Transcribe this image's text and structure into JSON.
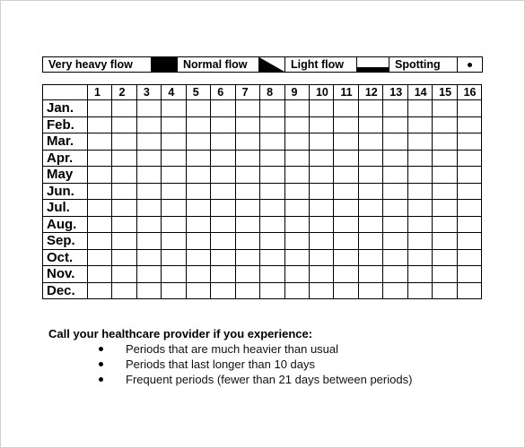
{
  "legend": {
    "items": [
      {
        "label": "Very heavy flow",
        "symbol": "solid-black-block"
      },
      {
        "label": "Normal flow",
        "symbol": "black-triangle"
      },
      {
        "label": "Light flow",
        "symbol": "bottom-black-bar"
      },
      {
        "label": "Spotting",
        "symbol": "dot"
      }
    ]
  },
  "calendar": {
    "days": [
      "1",
      "2",
      "3",
      "4",
      "5",
      "6",
      "7",
      "8",
      "9",
      "10",
      "11",
      "12",
      "13",
      "14",
      "15",
      "16"
    ],
    "months": [
      "Jan.",
      "Feb.",
      "Mar.",
      "Apr.",
      "May",
      "Jun.",
      "Jul.",
      "Aug.",
      "Sep.",
      "Oct.",
      "Nov.",
      "Dec."
    ]
  },
  "notes": {
    "title": "Call your healthcare provider if you experience:",
    "items": [
      "Periods that are much heavier than usual",
      "Periods that last longer than 10 days",
      "Frequent periods (fewer than 21 days between periods)"
    ]
  }
}
